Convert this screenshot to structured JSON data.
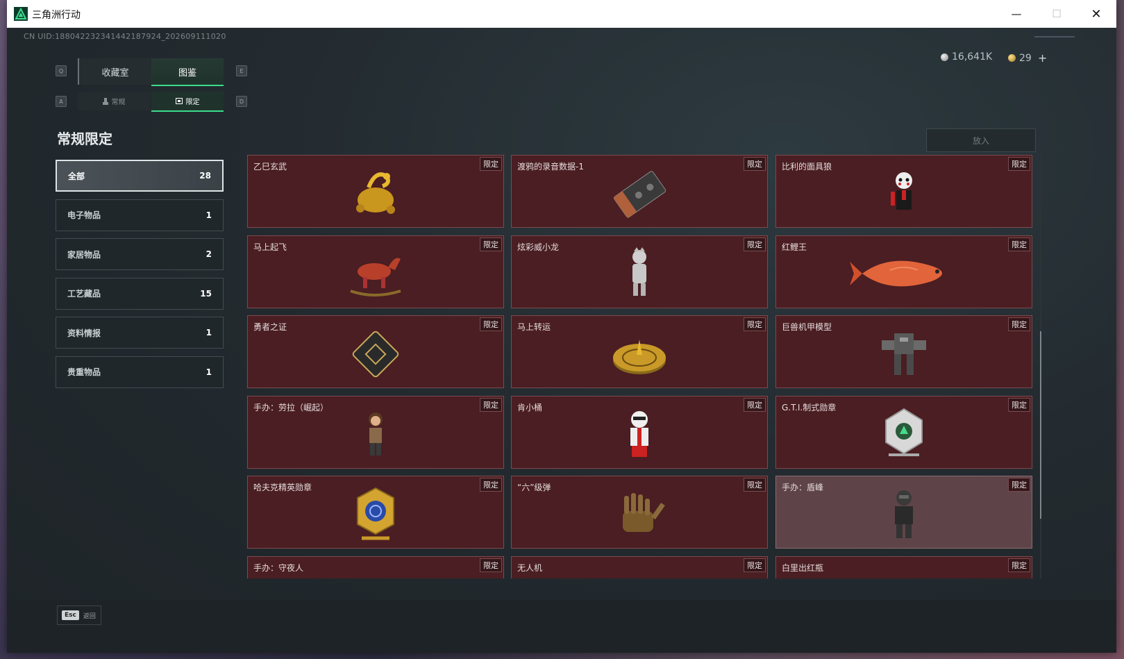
{
  "window": {
    "title": "三角洲行动"
  },
  "uid": "CN UID:18804223234144218792­4_202609111020",
  "currency": {
    "silver": "16,641K",
    "gold": "29",
    "plus": "+"
  },
  "hotkeys": {
    "q": "Q",
    "e": "E",
    "a": "A",
    "d": "D"
  },
  "tabs": [
    {
      "label": "收藏室",
      "active": false
    },
    {
      "label": "图鉴",
      "active": true
    }
  ],
  "subtabs": [
    {
      "label": "常规",
      "active": false
    },
    {
      "label": "限定",
      "active": true
    }
  ],
  "section_title": "常规限定",
  "put_button": "放入",
  "categories": [
    {
      "label": "全部",
      "count": "28",
      "active": true
    },
    {
      "label": "电子物品",
      "count": "1"
    },
    {
      "label": "家居物品",
      "count": "2"
    },
    {
      "label": "工艺藏品",
      "count": "15"
    },
    {
      "label": "资料情报",
      "count": "1"
    },
    {
      "label": "贵重物品",
      "count": "1"
    }
  ],
  "badge_label": "限定",
  "items": [
    {
      "name": "乙巳玄武",
      "icon": "golden-turtle-snake-icon"
    },
    {
      "name": "渡鸦的录音数据-1",
      "icon": "cassette-tape-icon"
    },
    {
      "name": "比利的面具狼",
      "icon": "puppet-mask-icon"
    },
    {
      "name": "马上起飞",
      "icon": "red-horse-icon"
    },
    {
      "name": "炫彩威小龙",
      "icon": "silver-dragon-figure-icon"
    },
    {
      "name": "红鲤王",
      "icon": "red-carp-icon"
    },
    {
      "name": "勇者之证",
      "icon": "black-card-icon"
    },
    {
      "name": "马上转运",
      "icon": "golden-disc-icon"
    },
    {
      "name": "巨兽机甲模型",
      "icon": "mech-model-icon"
    },
    {
      "name": "手办：劳拉（崛起）",
      "icon": "lara-figure-icon"
    },
    {
      "name": "肯小桶",
      "icon": "kfc-bucket-figure-icon"
    },
    {
      "name": "G.T.I.制式勋章",
      "icon": "gti-medal-icon"
    },
    {
      "name": "哈夫克精英勋章",
      "icon": "haavk-medal-icon"
    },
    {
      "name": "“六”级弹",
      "icon": "glove-hand-icon"
    },
    {
      "name": "手办：盾峰",
      "icon": "armored-figure-icon",
      "dim": true
    },
    {
      "name": "手办：守夜人",
      "icon": "nightwatch-figure-icon"
    },
    {
      "name": "无人机",
      "icon": "drone-icon"
    },
    {
      "name": "白里出红瓶",
      "icon": "porcelain-vase-icon"
    }
  ],
  "footer": {
    "esc_key": "Esc",
    "back_label": "返回"
  }
}
